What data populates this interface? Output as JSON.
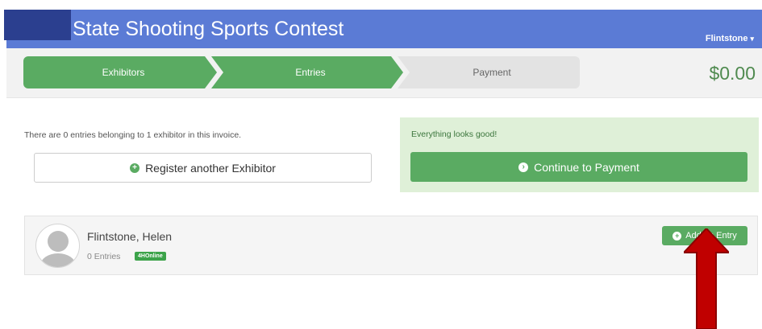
{
  "header": {
    "title": "State Shooting Sports Contest",
    "user_name": "Flintstone",
    "user_caret": "▾"
  },
  "steps": {
    "exhibitors": "Exhibitors",
    "entries": "Entries",
    "payment": "Payment"
  },
  "total": "$0.00",
  "summary": {
    "text": "There are 0 entries belonging to 1 exhibitor in this invoice.",
    "register_button": "Register another Exhibitor",
    "register_icon": "plus-circle-icon"
  },
  "status": {
    "message": "Everything looks good!",
    "continue_button": "Continue to Payment",
    "continue_icon": "arrow-right-circle-icon"
  },
  "exhibitor": {
    "name": "Flintstone, Helen",
    "entries": "0 Entries",
    "badge": "4HOnline",
    "add_entry_button": "Add an Entry",
    "add_icon": "plus-circle-icon"
  },
  "colors": {
    "header": "#5b7bd5",
    "success": "#5aab62",
    "success_bg": "#dff0d8",
    "arrow": "#c00000"
  }
}
